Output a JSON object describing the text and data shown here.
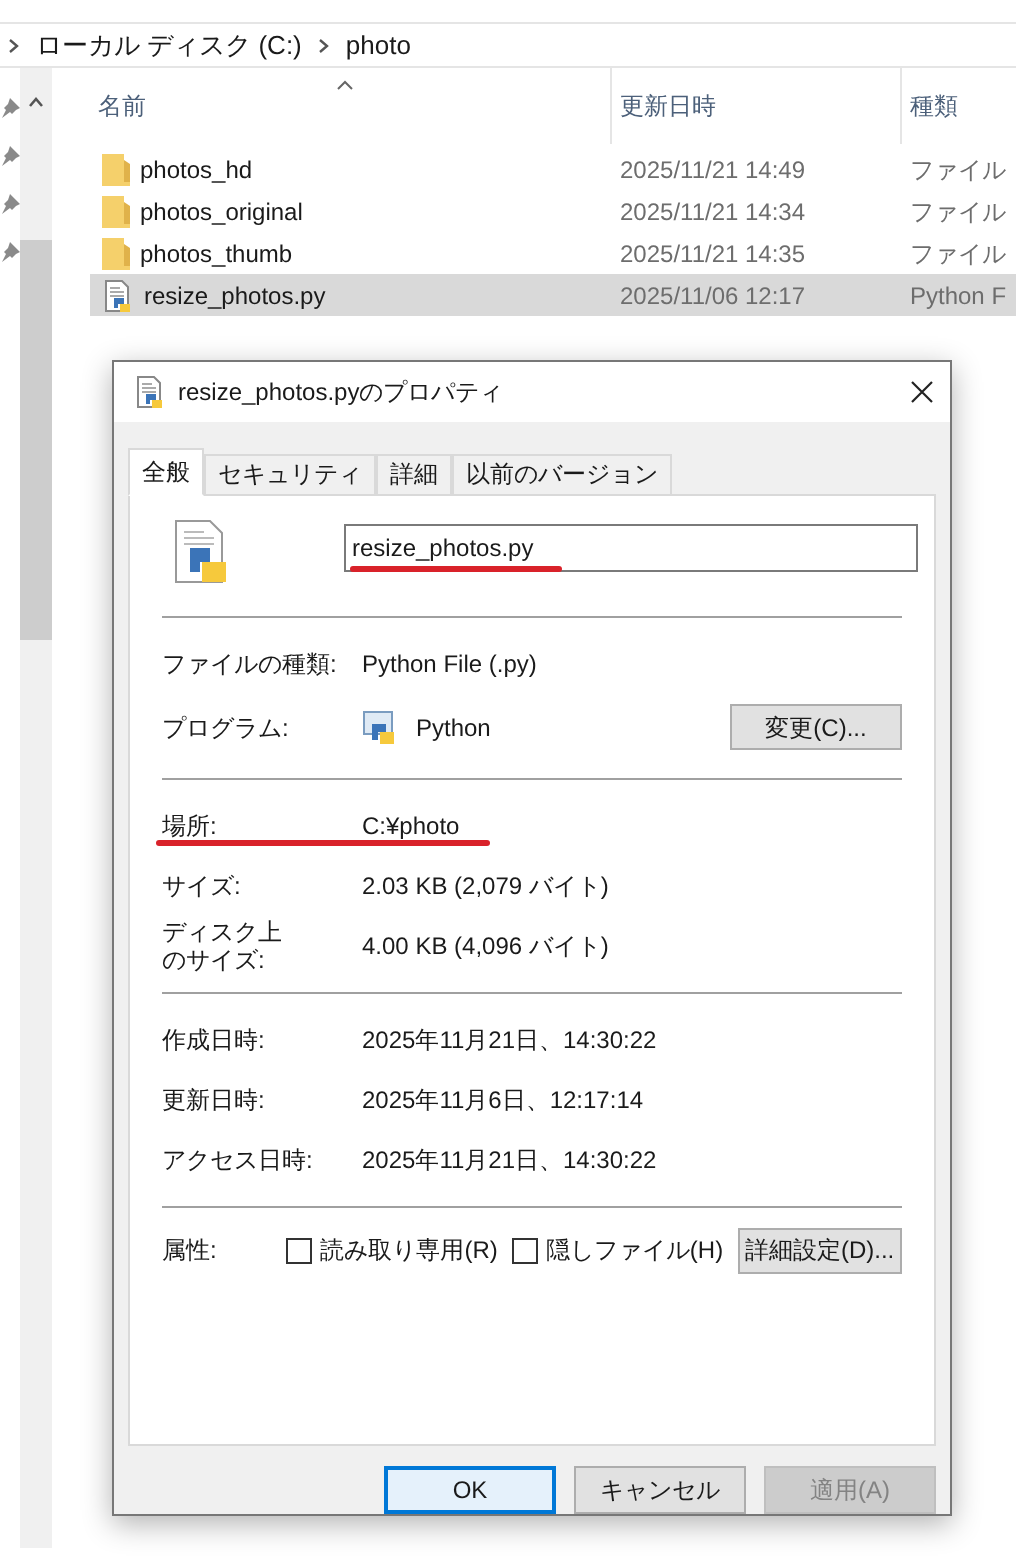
{
  "breadcrumb": [
    {
      "label": "ローカル ディスク (C:)"
    },
    {
      "label": "photo"
    }
  ],
  "file_list": {
    "columns": [
      "名前",
      "更新日時",
      "種類"
    ],
    "rows": [
      {
        "kind": "folder",
        "name": "photos_hd",
        "modified": "2025/11/21 14:49",
        "type": "ファイル",
        "selected": false
      },
      {
        "kind": "folder",
        "name": "photos_original",
        "modified": "2025/11/21 14:34",
        "type": "ファイル",
        "selected": false
      },
      {
        "kind": "folder",
        "name": "photos_thumb",
        "modified": "2025/11/21 14:35",
        "type": "ファイル",
        "selected": false
      },
      {
        "kind": "python",
        "name": "resize_photos.py",
        "modified": "2025/11/06 12:17",
        "type": "Python F",
        "selected": true
      }
    ]
  },
  "dialog": {
    "title": "resize_photos.pyのプロパティ",
    "tabs": [
      {
        "label": "全般",
        "selected": true
      },
      {
        "label": "セキュリティ",
        "selected": false
      },
      {
        "label": "詳細",
        "selected": false
      },
      {
        "label": "以前のバージョン",
        "selected": false
      }
    ],
    "file_name": {
      "value": "resize_photos.py",
      "underlined": true
    },
    "sections": [
      [
        {
          "kind": "text",
          "label": "ファイルの種類:",
          "value": "Python File (.py)",
          "underlined": false
        },
        {
          "kind": "program",
          "label": "プログラム:",
          "value": "Python",
          "button": "変更(C)...",
          "underlined": false
        }
      ],
      [
        {
          "kind": "text",
          "label": "場所:",
          "value": "C:¥photo",
          "underlined": true
        },
        {
          "kind": "text",
          "label": "サイズ:",
          "value": "2.03 KB (2,079 バイト)",
          "underlined": false
        },
        {
          "kind": "text",
          "label": [
            "ディスク上",
            "のサイズ:"
          ],
          "value": "4.00 KB (4,096 バイト)",
          "underlined": false
        }
      ],
      [
        {
          "kind": "text",
          "label": "作成日時:",
          "value": "2025年11月21日、14:30:22",
          "underlined": false
        },
        {
          "kind": "text",
          "label": "更新日時:",
          "value": "2025年11月6日、12:17:14",
          "underlined": false
        },
        {
          "kind": "text",
          "label": "アクセス日時:",
          "value": "2025年11月21日、14:30:22",
          "underlined": false
        }
      ]
    ],
    "attributes": {
      "label": "属性:",
      "checkboxes": [
        {
          "label": "読み取り専用(R)",
          "checked": false
        },
        {
          "label": "隠しファイル(H)",
          "checked": false
        }
      ],
      "button": "詳細設定(D)..."
    },
    "buttons": [
      {
        "label": "OK",
        "kind": "default",
        "disabled": false
      },
      {
        "label": "キャンセル",
        "kind": "normal",
        "disabled": false
      },
      {
        "label": "適用(A)",
        "kind": "normal",
        "disabled": true
      }
    ]
  }
}
